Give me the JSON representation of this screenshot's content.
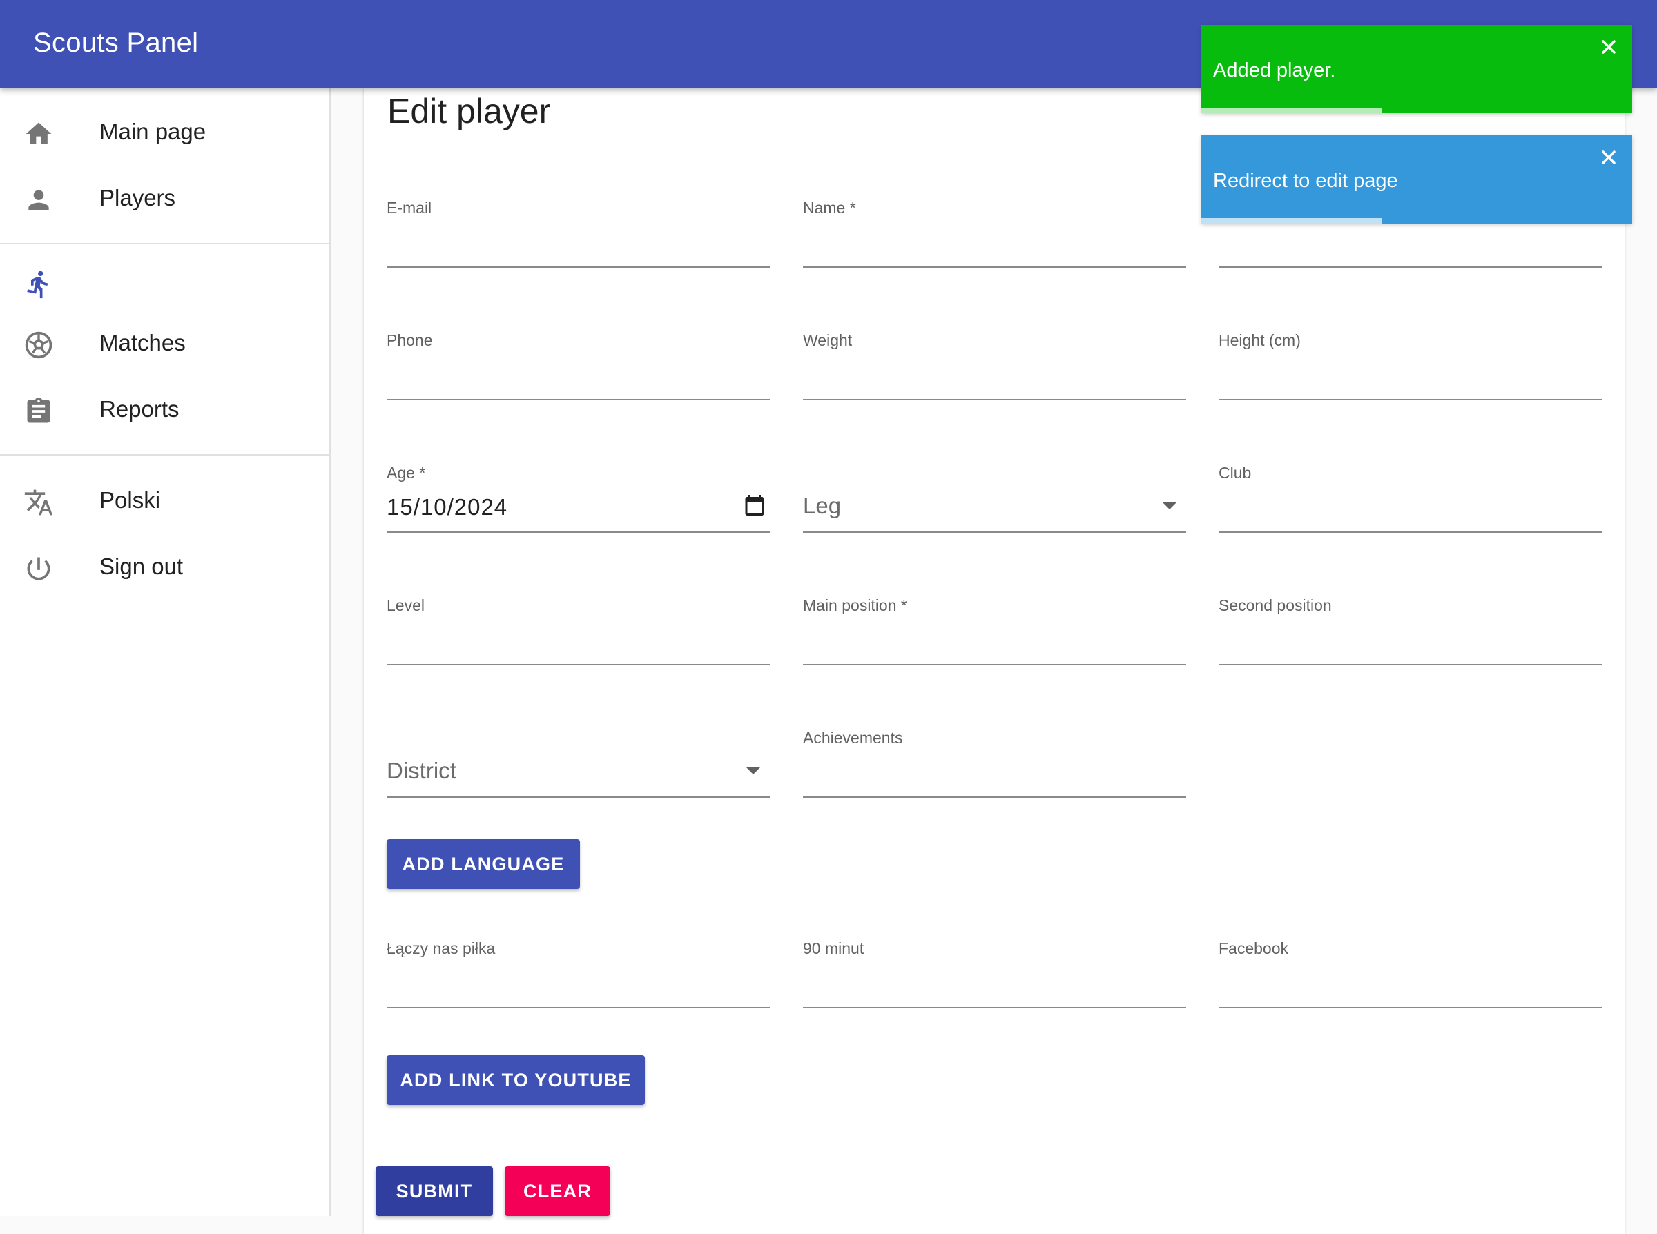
{
  "app": {
    "title": "Scouts Panel"
  },
  "sidebar": {
    "items": [
      {
        "label": "Main page",
        "icon": "home-icon"
      },
      {
        "label": "Players",
        "icon": "person-icon"
      },
      {
        "label": "",
        "icon": "running-icon"
      },
      {
        "label": "Matches",
        "icon": "soccer-ball-icon"
      },
      {
        "label": "Reports",
        "icon": "clipboard-icon"
      },
      {
        "label": "Polski",
        "icon": "translate-icon"
      },
      {
        "label": "Sign out",
        "icon": "power-icon"
      }
    ],
    "active_icon_color": "#3f51b5"
  },
  "form": {
    "title": "Edit player",
    "email": {
      "label": "E-mail"
    },
    "name": {
      "label": "Name *"
    },
    "phone": {
      "label": "Phone"
    },
    "weight": {
      "label": "Weight"
    },
    "height": {
      "label": "Height (cm)"
    },
    "age": {
      "label": "Age *",
      "value": "15/10/2024"
    },
    "leg": {
      "placeholder": "Leg"
    },
    "club": {
      "label": "Club"
    },
    "level": {
      "label": "Level"
    },
    "main_position": {
      "label": "Main position *"
    },
    "second_position": {
      "label": "Second position"
    },
    "district": {
      "placeholder": "District"
    },
    "achievements": {
      "label": "Achievements"
    },
    "add_language_label": "ADD LANGUAGE",
    "laczy_nas_pilka": {
      "label": "Łączy nas piłka"
    },
    "minut90": {
      "label": "90 minut"
    },
    "facebook": {
      "label": "Facebook"
    },
    "add_youtube_label": "ADD LINK TO YOUTUBE",
    "submit_label": "SUBMIT",
    "clear_label": "CLEAR"
  },
  "toasts": [
    {
      "message": "Added player.",
      "type": "success",
      "color": "#07bc0c",
      "progress": 0.42
    },
    {
      "message": "Redirect to edit page",
      "type": "info",
      "color": "#3498db",
      "progress": 0.42
    }
  ],
  "colors": {
    "primary": "#3f51b5",
    "primary_dark": "#303f9f",
    "secondary": "#f50057"
  }
}
